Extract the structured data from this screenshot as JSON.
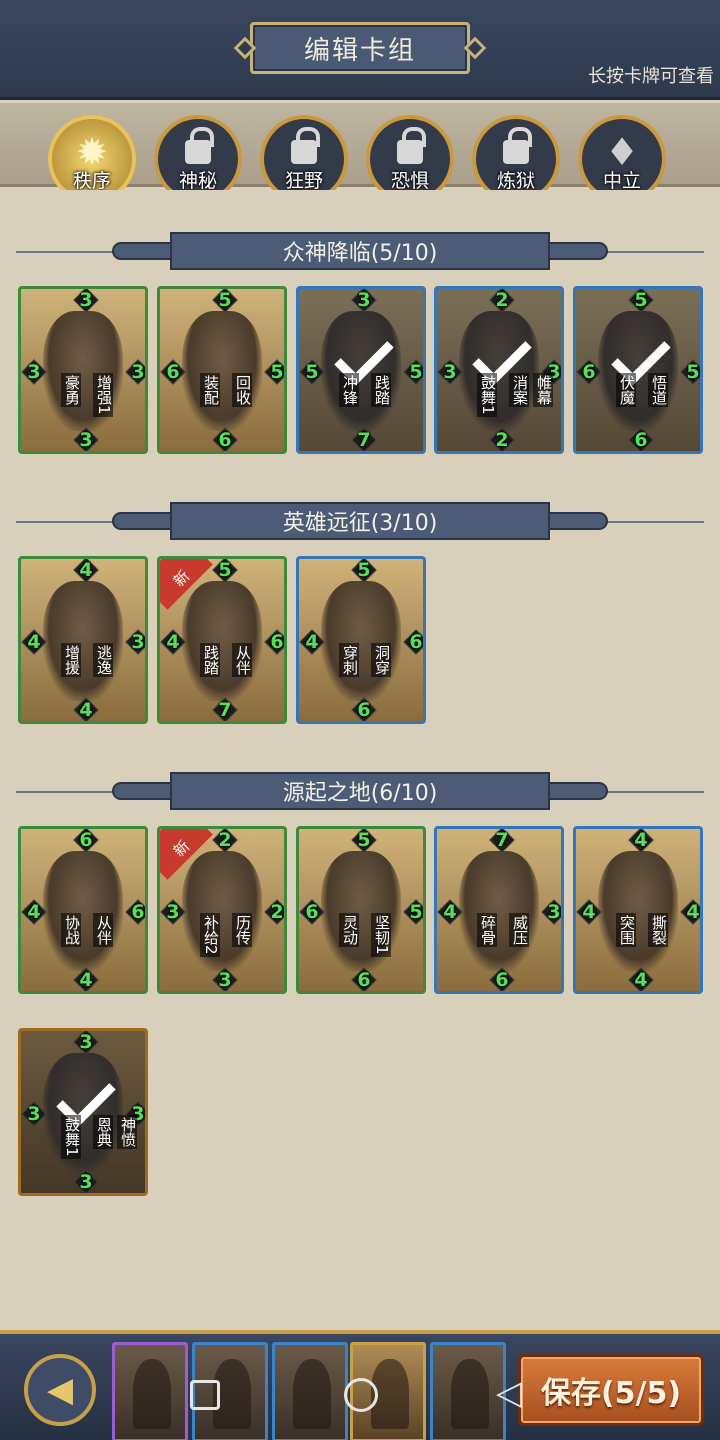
{
  "header": {
    "title": "编辑卡组",
    "hint": "长按卡牌可查看"
  },
  "factions": [
    {
      "name": "秩序",
      "locked": false
    },
    {
      "name": "神秘",
      "locked": true
    },
    {
      "name": "狂野",
      "locked": true
    },
    {
      "name": "恐惧",
      "locked": true
    },
    {
      "name": "炼狱",
      "locked": true
    },
    {
      "name": "中立",
      "locked": false
    }
  ],
  "sections": [
    {
      "title": "众神降临(5/10)"
    },
    {
      "title": "英雄远征(3/10)"
    },
    {
      "title": "源起之地(6/10)"
    }
  ],
  "cards": [
    {
      "top": "3",
      "left": "3",
      "right": "3",
      "bottom": "3",
      "skill1": "豪勇",
      "skill2": "增强1",
      "border": "green",
      "selected": false,
      "new": false
    },
    {
      "top": "5",
      "left": "6",
      "right": "5",
      "bottom": "6",
      "skill1": "装配",
      "skill2": "回收",
      "border": "green",
      "selected": false,
      "new": false
    },
    {
      "top": "3",
      "left": "5",
      "right": "5",
      "bottom": "7",
      "skill1": "冲锋",
      "skill2": "践踏",
      "border": "blue",
      "selected": true,
      "new": false
    },
    {
      "top": "2",
      "left": "3",
      "right": "3",
      "bottom": "2",
      "skill1": "鼓舞1",
      "skill2": "消案",
      "skill3": "帷幕",
      "border": "blue",
      "selected": true,
      "new": false
    },
    {
      "top": "5",
      "left": "6",
      "right": "5",
      "bottom": "6",
      "skill1": "伏魔",
      "skill2": "悟道",
      "border": "blue",
      "selected": true,
      "new": false
    },
    {
      "top": "4",
      "left": "4",
      "right": "3",
      "bottom": "4",
      "skill1": "增援",
      "skill2": "逃逸",
      "border": "green",
      "selected": false,
      "new": false
    },
    {
      "top": "5",
      "left": "4",
      "right": "6",
      "bottom": "7",
      "skill1": "践踏",
      "skill2": "从伴",
      "border": "green",
      "selected": false,
      "new": true
    },
    {
      "top": "5",
      "left": "4",
      "right": "6",
      "bottom": "6",
      "skill1": "穿刺",
      "skill2": "洞穿",
      "border": "blue",
      "selected": false,
      "new": false
    },
    {
      "top": "6",
      "left": "4",
      "right": "6",
      "bottom": "4",
      "skill1": "协战",
      "skill2": "从伴",
      "border": "green",
      "selected": false,
      "new": false
    },
    {
      "top": "2",
      "left": "3",
      "right": "2",
      "bottom": "3",
      "skill1": "补给2",
      "skill2": "历传",
      "border": "green",
      "selected": false,
      "new": true
    },
    {
      "top": "5",
      "left": "6",
      "right": "5",
      "bottom": "6",
      "skill1": "灵动",
      "skill2": "坚韧1",
      "border": "green",
      "selected": false,
      "new": false
    },
    {
      "top": "7",
      "left": "4",
      "right": "3",
      "bottom": "6",
      "skill1": "碎骨",
      "skill2": "威压",
      "border": "blue",
      "selected": false,
      "new": false
    },
    {
      "top": "4",
      "left": "4",
      "right": "4",
      "bottom": "4",
      "skill1": "突围",
      "skill2": "撕裂",
      "border": "blue",
      "selected": false,
      "new": false
    },
    {
      "top": "3",
      "left": "3",
      "right": "3",
      "bottom": "3",
      "skill1": "鼓舞1",
      "skill2": "恩典",
      "skill3": "神愤",
      "border": "gold",
      "selected": true,
      "new": false
    }
  ],
  "new_label": "新",
  "footer": {
    "back_icon": "◀",
    "save_label": "保存(5/5)",
    "deck_slots": 5
  },
  "colors": {
    "accent": "#c9a04a",
    "green_border": "#3d8a3a",
    "blue_border": "#3576b8",
    "save": "#c9662d"
  }
}
